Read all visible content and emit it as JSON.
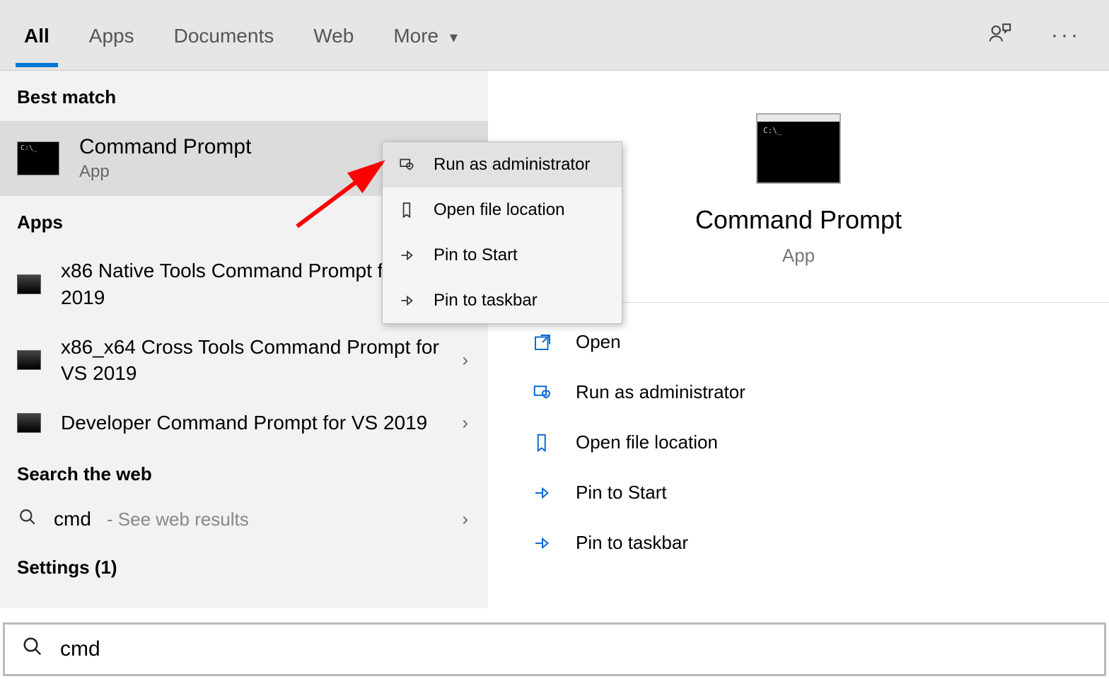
{
  "tabs": {
    "all": "All",
    "apps": "Apps",
    "documents": "Documents",
    "web": "Web",
    "more": "More"
  },
  "left": {
    "best_match_header": "Best match",
    "best_match_title": "Command Prompt",
    "best_match_sub": "App",
    "apps_header": "Apps",
    "app1": "x86 Native Tools Command Prompt for VS 2019",
    "app2": "x86_x64 Cross Tools Command Prompt for VS 2019",
    "app3": "Developer Command Prompt for VS 2019",
    "web_header": "Search the web",
    "web_query": "cmd",
    "web_hint": " - See web results",
    "settings_header": "Settings (1)"
  },
  "ctx": {
    "run_admin": "Run as administrator",
    "open_loc": "Open file location",
    "pin_start": "Pin to Start",
    "pin_taskbar": "Pin to taskbar"
  },
  "detail": {
    "title": "Command Prompt",
    "sub": "App",
    "open": "Open",
    "run_admin": "Run as administrator",
    "open_loc": "Open file location",
    "pin_start": "Pin to Start",
    "pin_taskbar": "Pin to taskbar"
  },
  "search": {
    "value": "cmd"
  }
}
